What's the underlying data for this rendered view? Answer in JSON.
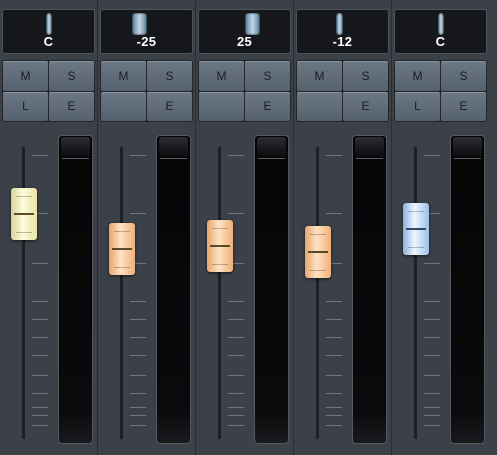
{
  "mixer": {
    "channels": [
      {
        "pan": {
          "label": "C",
          "value": 0
        },
        "buttons": [
          "M",
          "S",
          "L",
          "E"
        ],
        "fader": {
          "level": 0.77,
          "color": "yellow"
        },
        "meter": {
          "level": 0
        }
      },
      {
        "pan": {
          "label": "-25",
          "value": -25
        },
        "buttons": [
          "M",
          "S",
          "",
          "E"
        ],
        "fader": {
          "level": 0.65,
          "color": "orange"
        },
        "meter": {
          "level": 0
        }
      },
      {
        "pan": {
          "label": "25",
          "value": 25
        },
        "buttons": [
          "M",
          "S",
          "",
          "E"
        ],
        "fader": {
          "level": 0.66,
          "color": "orange"
        },
        "meter": {
          "level": 0
        }
      },
      {
        "pan": {
          "label": "-12",
          "value": -12
        },
        "buttons": [
          "M",
          "S",
          "",
          "E"
        ],
        "fader": {
          "level": 0.64,
          "color": "orange"
        },
        "meter": {
          "level": 0
        }
      },
      {
        "pan": {
          "label": "C",
          "value": 0
        },
        "buttons": [
          "M",
          "S",
          "L",
          "E"
        ],
        "fader": {
          "level": 0.72,
          "color": "blue"
        },
        "meter": {
          "level": 0
        }
      }
    ]
  },
  "colors": {
    "background": "#3c4048",
    "fader_yellow": "#fffddc",
    "fader_orange": "#ffe2c2",
    "fader_blue": "#eef6ff",
    "pan_indicator": "#c4d8e8"
  }
}
